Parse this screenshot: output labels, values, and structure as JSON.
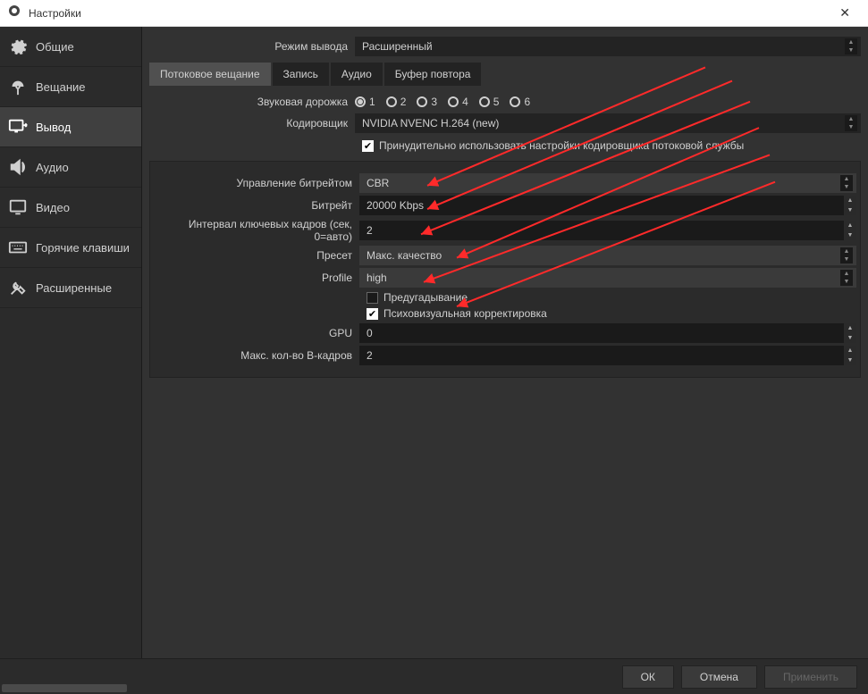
{
  "title": "Настройки",
  "sidebar": {
    "items": [
      {
        "label": "Общие"
      },
      {
        "label": "Вещание"
      },
      {
        "label": "Вывод"
      },
      {
        "label": "Аудио"
      },
      {
        "label": "Видео"
      },
      {
        "label": "Горячие клавиши"
      },
      {
        "label": "Расширенные"
      }
    ]
  },
  "output_mode": {
    "label": "Режим вывода",
    "value": "Расширенный"
  },
  "tabs": [
    {
      "label": "Потоковое вещание"
    },
    {
      "label": "Запись"
    },
    {
      "label": "Аудио"
    },
    {
      "label": "Буфер повтора"
    }
  ],
  "audio_track": {
    "label": "Звуковая дорожка",
    "options": [
      "1",
      "2",
      "3",
      "4",
      "5",
      "6"
    ],
    "selected": "1"
  },
  "encoder": {
    "label": "Кодировщик",
    "value": "NVIDIA NVENC H.264 (new)"
  },
  "enforce_cb": {
    "label": "Принудительно использовать настройки кодировщика потоковой службы",
    "checked": true
  },
  "panel": {
    "rate_control": {
      "label": "Управление битрейтом",
      "value": "CBR"
    },
    "bitrate": {
      "label": "Битрейт",
      "value": "20000 Kbps"
    },
    "keyint": {
      "label": "Интервал ключевых кадров (сек, 0=авто)",
      "value": "2"
    },
    "preset": {
      "label": "Пресет",
      "value": "Макс. качество"
    },
    "profile": {
      "label": "Profile",
      "value": "high"
    },
    "lookahead": {
      "label": "Предугадывание",
      "checked": false
    },
    "psycho": {
      "label": "Психовизуальная корректировка",
      "checked": true
    },
    "gpu": {
      "label": "GPU",
      "value": "0"
    },
    "bframes": {
      "label": "Макс. кол-во B-кадров",
      "value": "2"
    }
  },
  "footer": {
    "ok": "ОК",
    "cancel": "Отмена",
    "apply": "Применить"
  }
}
